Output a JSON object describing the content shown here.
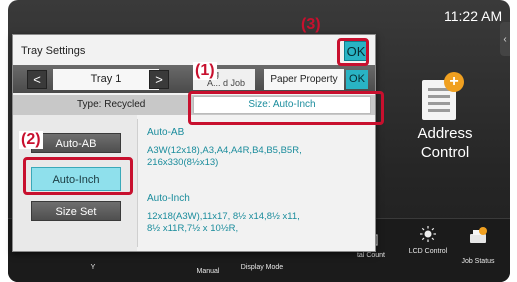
{
  "status": {
    "time": "11:22 AM"
  },
  "home": {
    "address_tile": {
      "line1": "Address",
      "line2": "Control"
    },
    "dock": [
      {
        "label": "Y",
        "icon": "none"
      },
      {
        "label": "Manual",
        "icon": "none"
      },
      {
        "label": "Display Mode",
        "icon": "none"
      },
      {
        "label": "tal Count",
        "icon": "counter-icon"
      },
      {
        "label": "LCD Control",
        "icon": "brightness-icon"
      },
      {
        "label": "Job Status",
        "icon": "job-status-icon"
      }
    ]
  },
  "dialog": {
    "title": "Tray Settings",
    "ok_label": "OK",
    "tray_name": "Tray 1",
    "prev_label": "<",
    "next_label": ">",
    "feed_tab_text": "ing\nA... d Job",
    "paper_property_label": "Paper Property",
    "ok_small_label": "OK",
    "type_text": "Type:  Recycled",
    "size_text": "Size: Auto-Inch",
    "options": [
      {
        "label": "Auto-AB",
        "selected": false
      },
      {
        "label": "Auto-Inch",
        "selected": true
      },
      {
        "label": "Size Set",
        "selected": false
      }
    ],
    "groups": [
      {
        "heading": "Auto-AB",
        "sizes": "A3W(12x18),A3,A4,A4R,B4,B5,B5R,\n216x330(8½x13)"
      },
      {
        "heading": "Auto-Inch",
        "sizes": "12x18(A3W),11x17, 8½ x14,8½ x11,\n8½ x11R,7½ x 10½R,"
      }
    ]
  },
  "callouts": {
    "one": "(1)",
    "two": "(2)",
    "three": "(3)"
  },
  "colors": {
    "accent": "#29b3c4",
    "annotation": "#c8102e",
    "text_teal": "#1a8c9c"
  }
}
